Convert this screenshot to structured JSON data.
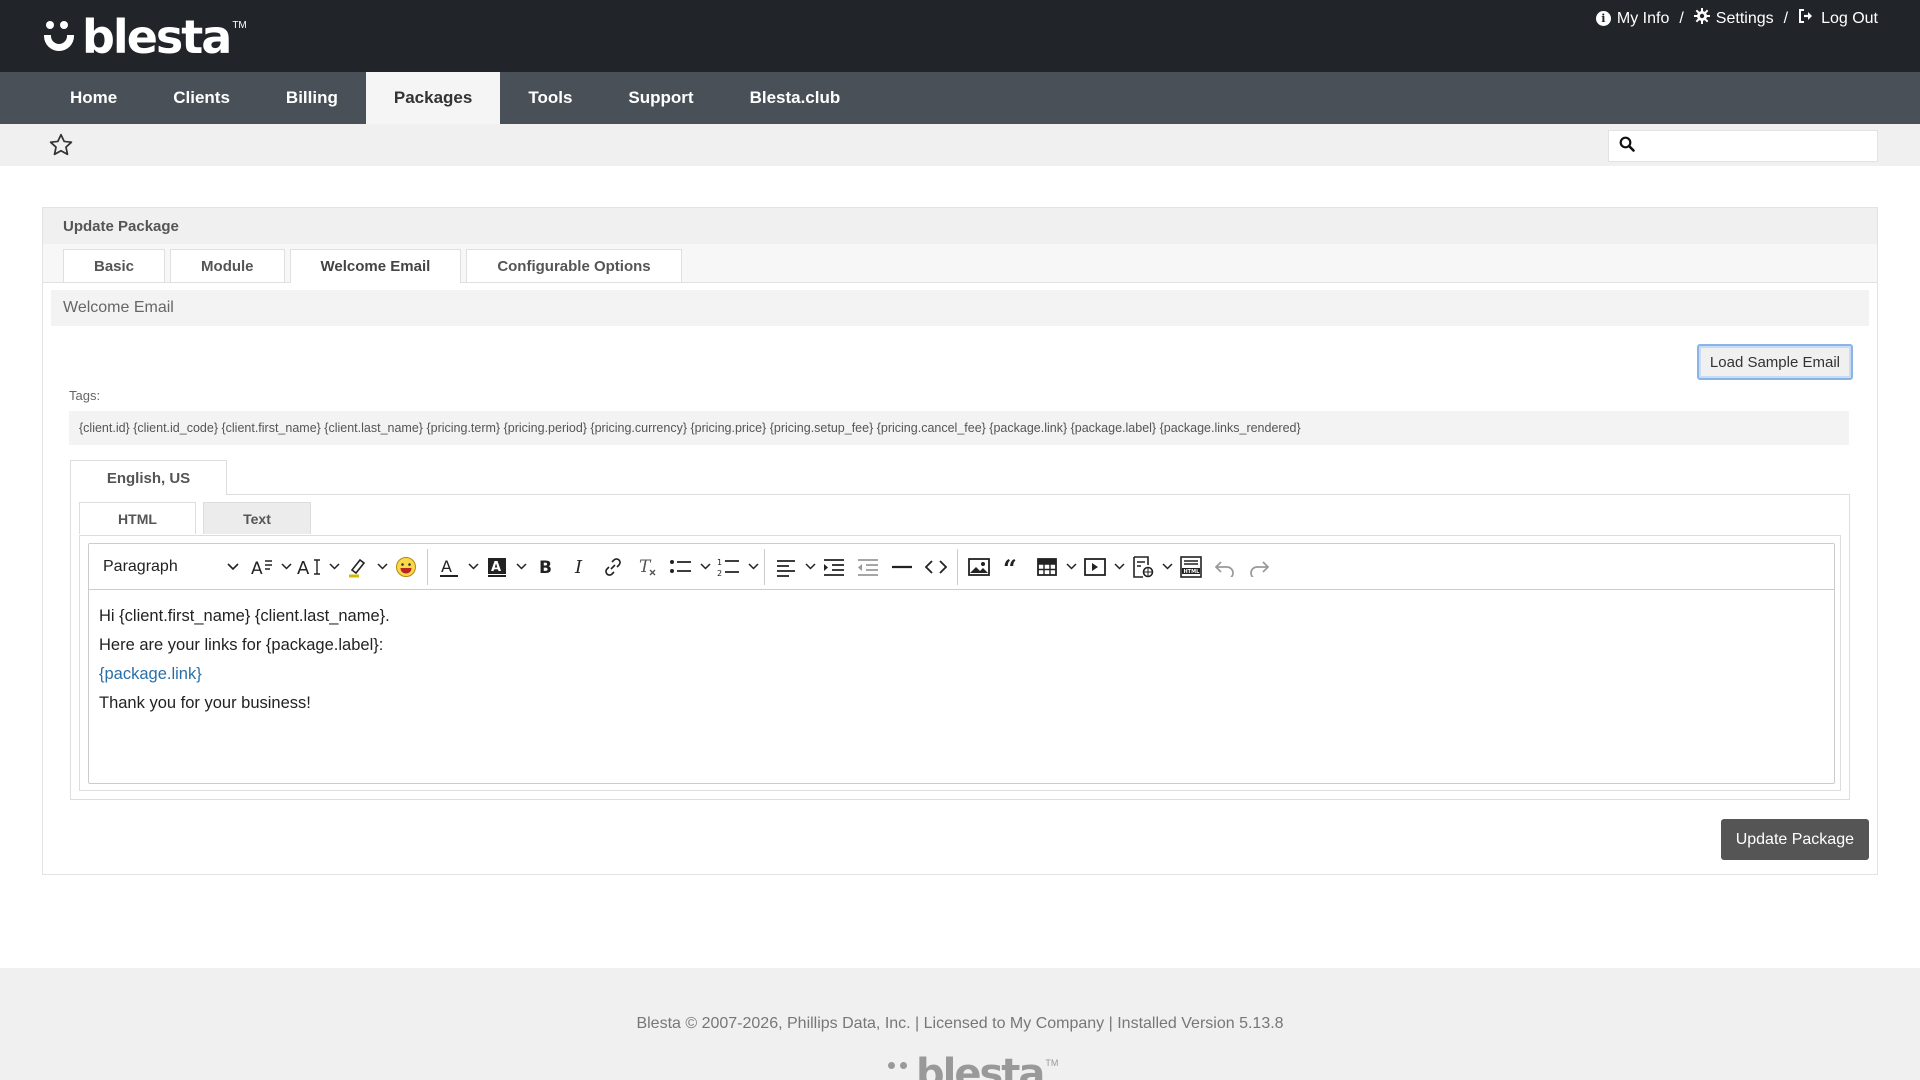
{
  "header": {
    "logo_text": "blesta",
    "logo_tm": "TM",
    "my_info": "My Info",
    "settings": "Settings",
    "log_out": "Log Out",
    "separator": "/"
  },
  "nav": {
    "items": [
      "Home",
      "Clients",
      "Billing",
      "Packages",
      "Tools",
      "Support",
      "Blesta.club"
    ],
    "active": "Packages"
  },
  "search": {
    "placeholder": ""
  },
  "panel": {
    "title": "Update Package",
    "tabs": [
      "Basic",
      "Module",
      "Welcome Email",
      "Configurable Options"
    ],
    "active_tab": "Welcome Email",
    "section_title": "Welcome Email",
    "load_sample_label": "Load Sample Email",
    "tags_label": "Tags:",
    "tags": "{client.id} {client.id_code} {client.first_name} {client.last_name} {pricing.term} {pricing.period} {pricing.currency} {pricing.price} {pricing.setup_fee} {pricing.cancel_fee} {package.link} {package.label} {package.links_rendered}",
    "language_tab": "English, US",
    "mode_tabs": [
      "HTML",
      "Text"
    ],
    "active_mode": "HTML",
    "update_label": "Update Package"
  },
  "editor": {
    "block_format": "Paragraph",
    "lines": [
      "Hi {client.first_name} {client.last_name}.",
      "Here are your links for {package.label}:",
      "{package.link}",
      "Thank you for your business!"
    ],
    "link_color": "#2a6fa8"
  },
  "footer": {
    "text": "Blesta © 2007-2026, Phillips Data, Inc. | Licensed to My Company | Installed Version 5.13.8",
    "logo_text": "blesta",
    "logo_tm": "TM"
  },
  "colors": {
    "header_bg": "#212529",
    "nav_bg": "#495057",
    "active_tab_bg": "#f5f5f5",
    "button_dark": "#555555"
  }
}
